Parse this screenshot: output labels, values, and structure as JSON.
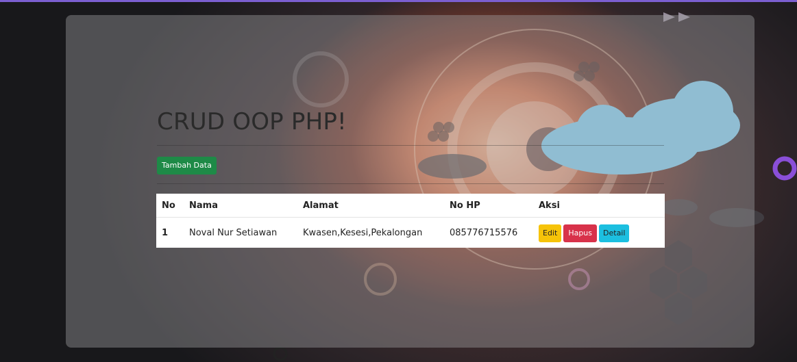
{
  "page": {
    "title": "CRUD OOP PHP!",
    "add_button_label": "Tambah Data"
  },
  "table": {
    "headers": {
      "no": "No",
      "nama": "Nama",
      "alamat": "Alamat",
      "no_hp": "No HP",
      "aksi": "Aksi"
    },
    "rows": [
      {
        "no": "1",
        "nama": "Noval Nur Setiawan",
        "alamat": "Kwasen,Kesesi,Pekalongan",
        "no_hp": "085776715576",
        "actions": {
          "edit": "Edit",
          "hapus": "Hapus",
          "detail": "Detail"
        }
      }
    ]
  },
  "colors": {
    "tambah": "#1e8a47",
    "edit": "#f6c309",
    "hapus": "#d8324a",
    "detail": "#1cbfe0",
    "top_border": "#7b5fd0"
  }
}
